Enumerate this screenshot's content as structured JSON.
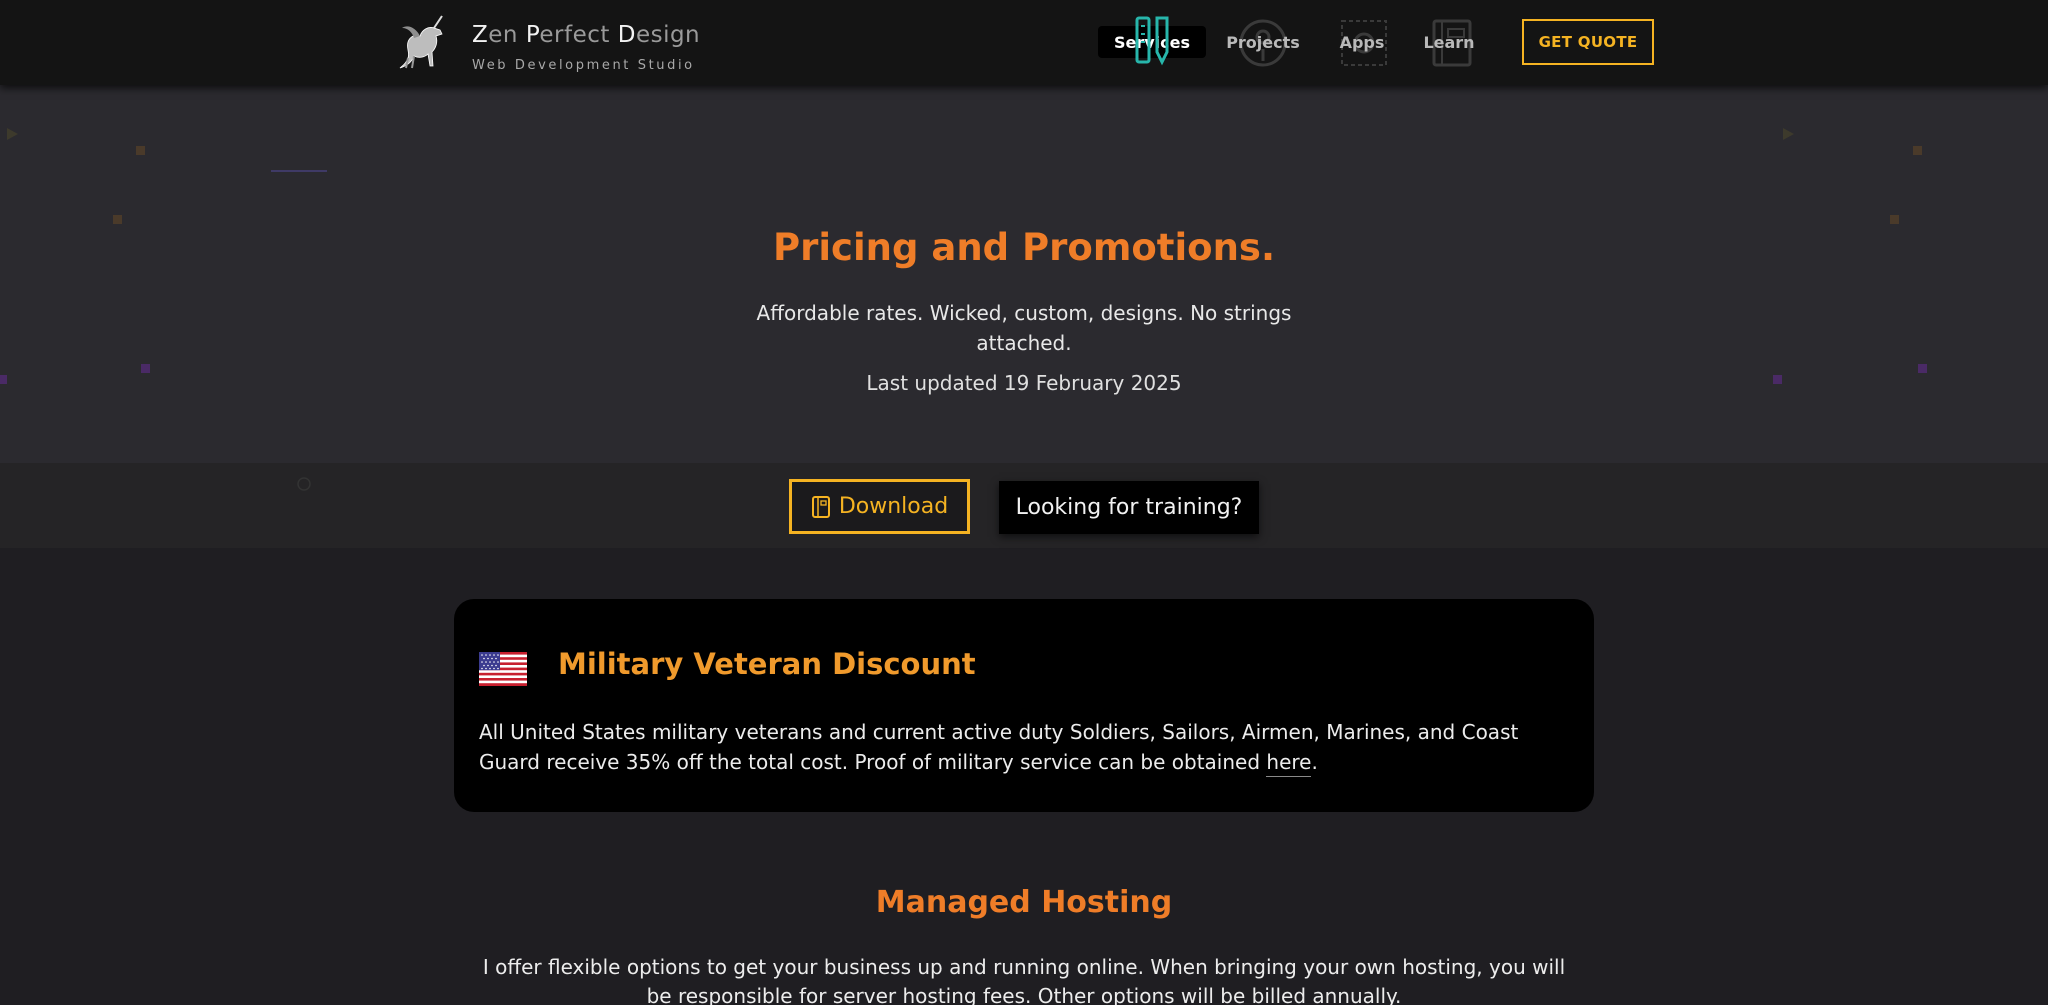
{
  "header": {
    "logo": {
      "title_parts": [
        {
          "text": "Z",
          "cap": true
        },
        {
          "text": "en ",
          "cap": false
        },
        {
          "text": "P",
          "cap": true
        },
        {
          "text": "erfect ",
          "cap": false
        },
        {
          "text": "D",
          "cap": true
        },
        {
          "text": "esign",
          "cap": false
        }
      ],
      "subtitle": "Web Development Studio",
      "icon": "unicorn-logo-icon"
    },
    "nav": [
      {
        "label": "Services",
        "icon": "pen-ruler-icon",
        "active": true
      },
      {
        "label": "Projects",
        "icon": "map-pin-icon",
        "active": false
      },
      {
        "label": "Apps",
        "icon": "gear-icon",
        "active": false
      },
      {
        "label": "Learn",
        "icon": "notebook-icon",
        "active": false
      }
    ],
    "cta_label": "GET QUOTE"
  },
  "hero": {
    "title": "Pricing and Promotions.",
    "subtitle": "Affordable rates. Wicked, custom, designs. No strings attached.",
    "updated": "Last updated 19 February 2025"
  },
  "actions": {
    "download_label": "Download",
    "download_icon": "document-icon",
    "training_label": "Looking for training?"
  },
  "veteran": {
    "flag_icon": "us-flag-icon",
    "title": "Military Veteran Discount",
    "text_before_link": "All United States military veterans and current active duty Soldiers, Sailors, Airmen, Marines, and Coast Guard receive 35% off the total cost. Proof of military service can be obtained ",
    "link_label": "here",
    "text_after_link": "."
  },
  "hosting": {
    "title": "Managed Hosting",
    "text": "I offer flexible options to get your business up and running online. When bringing your own hosting, you will be responsible for server hosting fees. Other options will be billed annually."
  },
  "colors": {
    "accent_orange": "#ef7d28",
    "accent_gold": "#f5b322",
    "header_bg": "#141414",
    "hero_bg": "#2b2a2f",
    "page_bg": "#1f1e22"
  }
}
